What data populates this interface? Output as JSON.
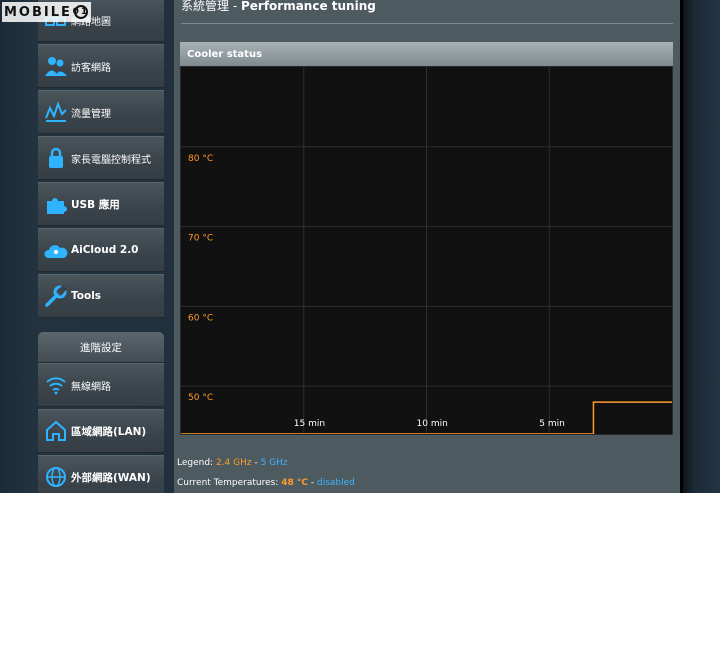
{
  "watermark": {
    "text": "MOBILE",
    "badge": "01"
  },
  "sidebar": {
    "items": [
      {
        "label": "網路地圖",
        "icon": "network-map-icon",
        "bold": false
      },
      {
        "label": "訪客網路",
        "icon": "guest-network-icon",
        "bold": false
      },
      {
        "label": "流量管理",
        "icon": "traffic-manager-icon",
        "bold": false
      },
      {
        "label": "家長電腦控制程式",
        "icon": "parental-control-icon",
        "bold": false
      },
      {
        "label": "USB 應用",
        "icon": "usb-application-icon",
        "bold": true
      },
      {
        "label": "AiCloud 2.0",
        "icon": "aicloud-icon",
        "bold": true
      },
      {
        "label": "Tools",
        "icon": "tools-icon",
        "bold": true
      }
    ],
    "advanced_header": "進階設定",
    "advanced_items": [
      {
        "label": "無線網路",
        "icon": "wireless-icon",
        "bold": false
      },
      {
        "label": "區域網路(LAN)",
        "icon": "lan-icon",
        "bold": true
      },
      {
        "label": "外部網路(WAN)",
        "icon": "wan-icon",
        "bold": true
      }
    ]
  },
  "page": {
    "title_prefix": "系統管理 - ",
    "title_main": "Performance tuning",
    "panel_title": "Cooler status"
  },
  "chart_data": {
    "type": "line",
    "title": "Cooler status",
    "y_tick_labels": [
      "80 °C",
      "70 °C",
      "60 °C",
      "50 °C"
    ],
    "y_ticks": [
      80,
      70,
      60,
      50
    ],
    "ylim": [
      44,
      90
    ],
    "x_tick_labels": [
      "15 min",
      "10 min",
      "5 min"
    ],
    "x_ticks_minutes_ago": [
      15,
      10,
      5
    ],
    "xlim_minutes_ago": [
      20,
      0
    ],
    "grid": true,
    "series": [
      {
        "name": "2.4 GHz",
        "color": "#ff9b2b",
        "x_minutes_ago": [
          20,
          3.2,
          3.2,
          0
        ],
        "values": [
          44,
          44,
          48,
          48
        ]
      }
    ]
  },
  "legend": {
    "prefix": "Legend: ",
    "item1": "2.4 GHz",
    "sep": " - ",
    "item2": "5 GHz"
  },
  "current": {
    "prefix": "Current Temperatures: ",
    "value1": "48 °C",
    "sep": " - ",
    "value2": "disabled"
  },
  "colors": {
    "accent_orange": "#ff9b2b",
    "accent_blue": "#3fb3ff",
    "icon_blue": "#2fb3ff"
  }
}
